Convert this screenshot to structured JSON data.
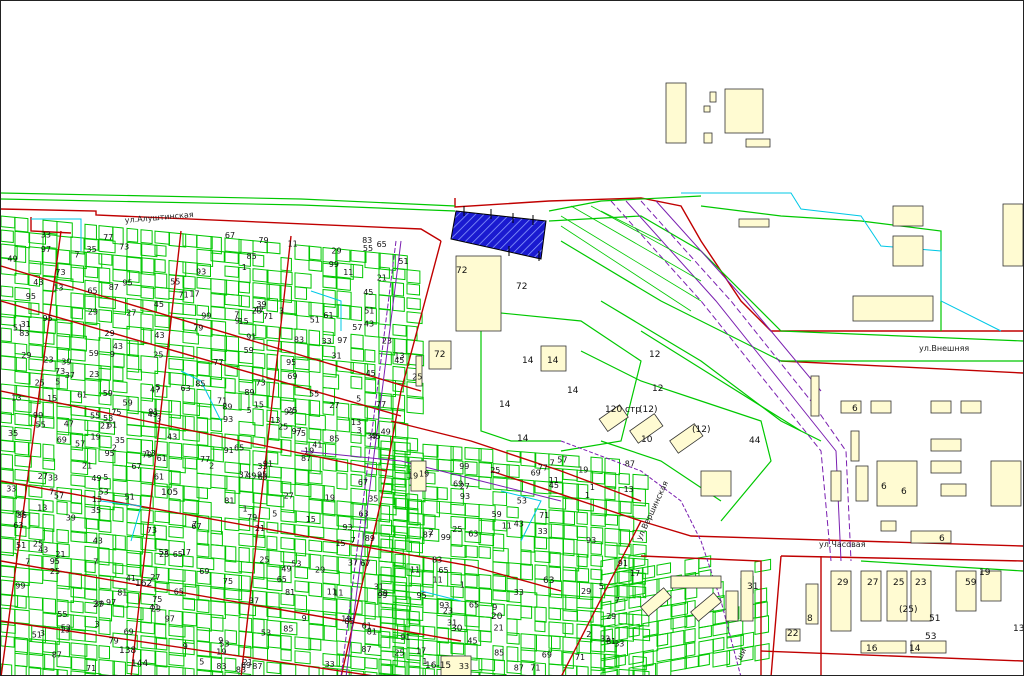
{
  "colors": {
    "background": "#ffffff",
    "parcel": "#00c800",
    "block_boundary": "#c00000",
    "building_fill": "#fffbd2",
    "building_stroke": "#333333",
    "railway": "#7a1fb0",
    "utility": "#00c8e6",
    "selected_fill": "#1010c0"
  },
  "streets": {
    "alushtinskaya": "ул.Алуштинская",
    "vneshnyaya": "ул.Внешняя",
    "vershinskaya": "ул.Вершинская",
    "chasovaya": "ул.Часовая",
    "partial_bottom": "ши"
  },
  "labels": {
    "n72": "72",
    "n14": "14",
    "n12": "12",
    "n12p": "(12)",
    "n120": "120 стр",
    "n10": "10",
    "n6": "6",
    "n8": "8",
    "n16": "16",
    "n22": "22",
    "n23": "23",
    "n25": "25",
    "n25p": "(25)",
    "n27": "27",
    "n29": "29",
    "n19": "19",
    "n13": "13",
    "n31": "31",
    "n59": "59",
    "n51": "51",
    "n53": "53",
    "n21": "21",
    "n1615": "16-15",
    "n30": "30",
    "n20": "20",
    "n44": "44",
    "n63": "63",
    "n138": "138",
    "n144": "144",
    "n162": "162",
    "n105": "105"
  }
}
